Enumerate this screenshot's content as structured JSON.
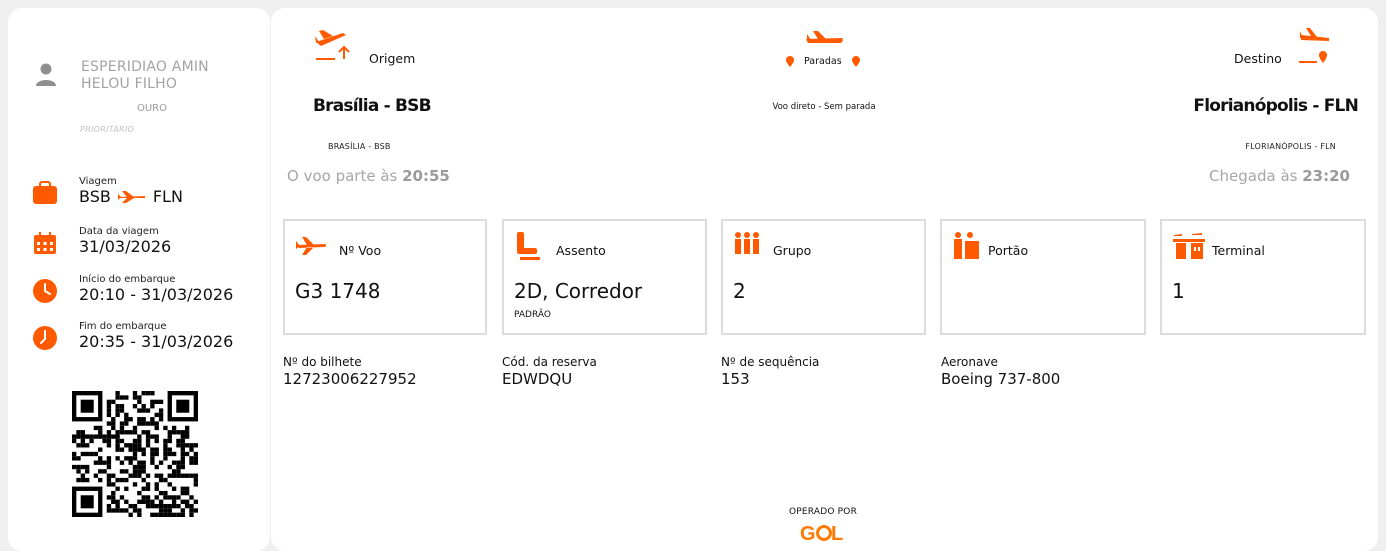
{
  "passenger": {
    "name": "ESPERIDIAO AMIN HELOU FILHO",
    "tier": "OURO",
    "priority": "PRIORITÁRIO"
  },
  "trip": {
    "label": "Viagem",
    "origin_code": "BSB",
    "destination_code": "FLN"
  },
  "travel_date": {
    "label": "Data da viagem",
    "value": "31/03/2026"
  },
  "boarding_start": {
    "label": "Início do embarque",
    "value": "20:10 - 31/03/2026"
  },
  "boarding_end": {
    "label": "Fim do embarque",
    "value": "20:35 - 31/03/2026"
  },
  "route": {
    "origin_label": "Origem",
    "origin_city": "Brasília - BSB",
    "origin_sub": "BRASÍLIA - BSB",
    "departure_text": "O voo parte às",
    "departure_time": "20:55",
    "stops_label": "Paradas",
    "stops_text": "Voo direto - Sem parada",
    "destination_label": "Destino",
    "destination_city": "Florianópolis - FLN",
    "destination_sub": "FLORIANÓPOLIS - FLN",
    "arrival_text": "Chegada às",
    "arrival_time": "23:20"
  },
  "boxes": {
    "flight": {
      "label": "Nº Voo",
      "value": "G3 1748",
      "icon": "plane-icon"
    },
    "seat": {
      "label": "Assento",
      "value": "2D, Corredor",
      "sub": "PADRÃO",
      "icon": "seat-icon"
    },
    "group": {
      "label": "Grupo",
      "value": "2",
      "icon": "group-icon"
    },
    "gate": {
      "label": "Portão",
      "value": "",
      "icon": "gate-icon"
    },
    "terminal": {
      "label": "Terminal",
      "value": "1",
      "icon": "terminal-icon"
    }
  },
  "details": {
    "ticket": {
      "label": "Nº do bilhete",
      "value": "12723006227952"
    },
    "booking": {
      "label": "Cód. da reserva",
      "value": "EDWDQU"
    },
    "sequence": {
      "label": "Nº de sequência",
      "value": "153"
    },
    "aircraft": {
      "label": "Aeronave",
      "value": "Boeing 737-800"
    }
  },
  "footer": {
    "operated_by": "OPERADO POR",
    "airline": "GOL"
  },
  "colors": {
    "accent": "#ff5a00",
    "muted": "#a3a3a3",
    "border": "#dcdcdc"
  }
}
